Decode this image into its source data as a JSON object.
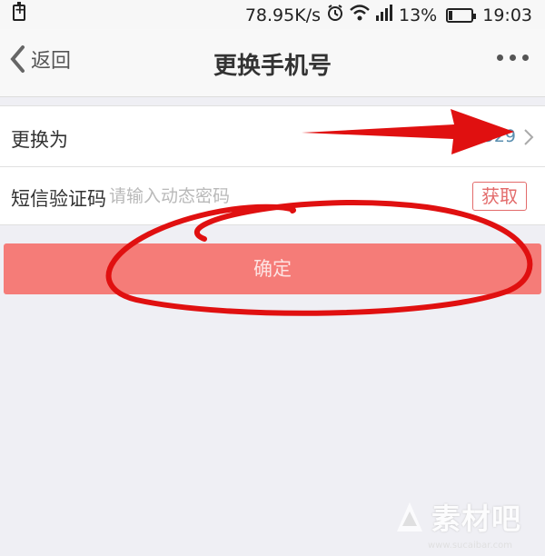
{
  "status_bar": {
    "speed": "78.95K/s",
    "battery_percent": "13%",
    "time": "19:03",
    "battery_level": 0.13
  },
  "nav": {
    "back_label": "返回",
    "title": "更换手机号"
  },
  "form": {
    "change_to_label": "更换为",
    "phone_value": "529",
    "sms_label": "短信验证码",
    "sms_placeholder": "请输入动态密码",
    "get_code_label": "获取"
  },
  "confirm_label": "确定",
  "watermark": {
    "text": "素材吧",
    "url": "www.sucaibar.com"
  },
  "colors": {
    "accent": "#f57c78",
    "annotation": "#e01010"
  }
}
